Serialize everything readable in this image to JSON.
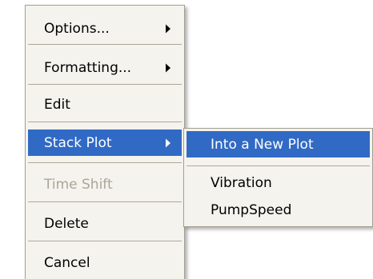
{
  "context_menu": {
    "items": [
      {
        "label": "Options...",
        "has_submenu": true,
        "state": "normal"
      },
      {
        "label": "Formatting...",
        "has_submenu": true,
        "state": "normal"
      },
      {
        "label": "Edit",
        "has_submenu": false,
        "state": "normal"
      },
      {
        "label": "Stack Plot",
        "has_submenu": true,
        "state": "highlighted"
      },
      {
        "label": "Time Shift",
        "has_submenu": false,
        "state": "disabled"
      },
      {
        "label": "Delete",
        "has_submenu": false,
        "state": "normal"
      },
      {
        "label": "Cancel",
        "has_submenu": false,
        "state": "normal"
      }
    ]
  },
  "submenu": {
    "items": [
      {
        "label": "Into a New Plot",
        "state": "highlighted"
      },
      {
        "label": "Vibration",
        "state": "normal"
      },
      {
        "label": "PumpSpeed",
        "state": "normal"
      }
    ]
  },
  "colors": {
    "menu_background": "#f4f3ee",
    "highlight": "#316ac5",
    "disabled_text": "#a9a797",
    "separator": "#aca899"
  },
  "icons": {
    "submenu_arrow": "triangle-right-icon"
  }
}
